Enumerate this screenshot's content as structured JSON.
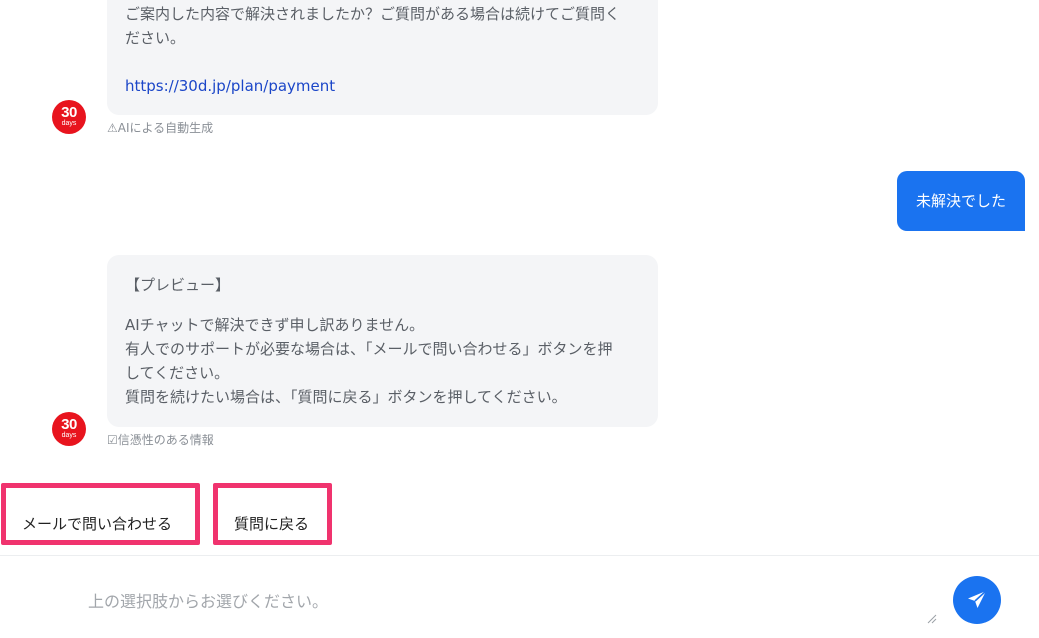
{
  "messages": {
    "bot1": {
      "line1": "ご案内した内容で解決されましたか？ご質問がある場合は続けてご質問く",
      "line2": "ださい。",
      "link": "https://30d.jp/plan/payment",
      "meta": "⚠AIによる自動生成"
    },
    "user1": {
      "text": "未解決でした"
    },
    "bot2": {
      "heading": "【プレビュー】",
      "line1": "AIチャットで解決できず申し訳ありません。",
      "line2": "有人でのサポートが必要な場合は、「メールで問い合わせる」ボタンを押",
      "line3": "してください。",
      "line4": "質問を続けたい場合は、「質問に戻る」ボタンを押してください。",
      "meta": "☑信憑性のある情報"
    }
  },
  "avatar": {
    "number": "30",
    "sub": "days",
    "color": "#e8141e"
  },
  "choices": {
    "email_label": "メールで問い合わせる",
    "back_label": "質問に戻る",
    "highlight_color": "#f0336e"
  },
  "composer": {
    "placeholder": "上の選択肢からお選びください。",
    "value": ""
  },
  "send_button": {
    "icon": "paper-plane-icon",
    "color": "#1a73f0"
  }
}
